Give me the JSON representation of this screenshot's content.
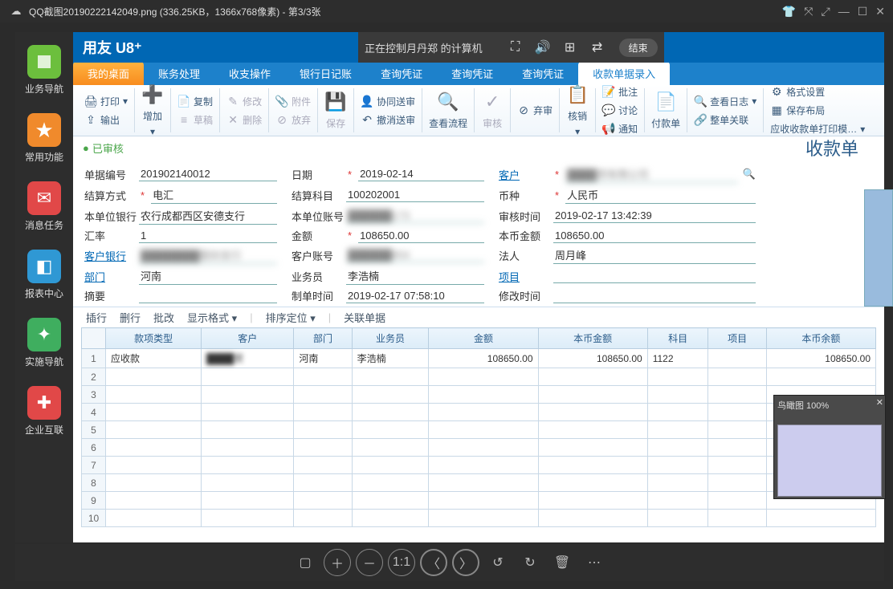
{
  "window": {
    "title": "QQ截图20190222142049.png (336.25KB，1366x768像素) - 第3/3张"
  },
  "remote": {
    "text": "正在控制月丹郑 的计算机",
    "end": "结束"
  },
  "app": {
    "logo": "用友 U8⁺"
  },
  "sidebar": {
    "items": [
      {
        "label": "业务导航",
        "color": "#6cbf3d"
      },
      {
        "label": "常用功能",
        "color": "#f08a2c"
      },
      {
        "label": "消息任务",
        "color": "#e14848"
      },
      {
        "label": "报表中心",
        "color": "#2f98d4"
      },
      {
        "label": "实施导航",
        "color": "#3fae5f"
      },
      {
        "label": "企业互联",
        "color": "#e14848"
      }
    ]
  },
  "tabs": {
    "items": [
      {
        "label": "我的桌面",
        "home": true
      },
      {
        "label": "账务处理"
      },
      {
        "label": "收支操作"
      },
      {
        "label": "银行日记账"
      },
      {
        "label": "查询凭证"
      },
      {
        "label": "查询凭证"
      },
      {
        "label": "查询凭证"
      },
      {
        "label": "收款单据录入",
        "active": true
      }
    ]
  },
  "ribbon": {
    "print": "打印",
    "output": "输出",
    "add": "增加",
    "copy": "复制",
    "draft": "草稿",
    "modify": "修改",
    "delete": "删除",
    "attach": "附件",
    "abandon": "放弃",
    "save": "保存",
    "coop": "协同送审",
    "undo": "撤消送审",
    "flow": "查看流程",
    "audit": "审核",
    "reject": "弃审",
    "verify": "核销",
    "note": "批注",
    "discuss": "讨论",
    "notify": "通知",
    "pay": "付款单",
    "log": "查看日志",
    "close": "整单关联",
    "format": "格式设置",
    "saveLayout": "保存布局",
    "template": "应收收款单打印模…"
  },
  "status": {
    "chip": "已审核",
    "doc_title": "收款单"
  },
  "form": {
    "doc_no_lab": "单据编号",
    "doc_no": "201902140012",
    "date_lab": "日期",
    "date": "2019-02-14",
    "customer_lab": "客户",
    "customer": "████贸有限公司",
    "settle_lab": "结算方式",
    "settle": "电汇",
    "subject_lab": "结算科目",
    "subject": "100202001",
    "currency_lab": "币种",
    "currency": "人民币",
    "bank_lab": "本单位银行",
    "bank": "农行成都西区安德支行",
    "acct_lab": "本单位账号",
    "acct": "██████173",
    "audit_time_lab": "审核时间",
    "audit_time": "2019-02-17 13:42:39",
    "rate_lab": "汇率",
    "rate": "1",
    "amount_lab": "金额",
    "amount": "108650.00",
    "local_amount_lab": "本币金额",
    "local_amount": "108650.00",
    "cust_bank_lab": "客户银行",
    "cust_bank": "████████登封支行",
    "cust_acct_lab": "客户账号",
    "cust_acct": "██████954",
    "legal_lab": "法人",
    "legal": "周月峰",
    "dept_lab": "部门",
    "dept": "河南",
    "sales_lab": "业务员",
    "sales": "李浩楠",
    "project_lab": "项目",
    "project": "",
    "summary_lab": "摘要",
    "summary": "",
    "create_time_lab": "制单时间",
    "create_time": "2019-02-17 07:58:10",
    "modify_time_lab": "修改时间",
    "modify_time": ""
  },
  "grid_toolbar": {
    "insert": "插行",
    "delete": "删行",
    "batch": "批改",
    "display": "显示格式",
    "sort": "排序定位",
    "assoc": "关联单据"
  },
  "grid": {
    "headers": [
      "款项类型",
      "客户",
      "部门",
      "业务员",
      "金额",
      "本币金额",
      "科目",
      "项目",
      "本币余额"
    ],
    "rows": [
      {
        "n": 1,
        "type": "应收款",
        "cust": "████贸",
        "dept": "河南",
        "sales": "李浩楠",
        "amt": "108650.00",
        "lamt": "108650.00",
        "subj": "1122",
        "proj": "",
        "bal": "108650.00"
      },
      {
        "n": 2
      },
      {
        "n": 3
      },
      {
        "n": 4
      },
      {
        "n": 5
      },
      {
        "n": 6
      },
      {
        "n": 7
      },
      {
        "n": 8
      },
      {
        "n": 9
      },
      {
        "n": 10
      }
    ]
  },
  "birdview": {
    "title": "鸟瞰图 100%"
  }
}
